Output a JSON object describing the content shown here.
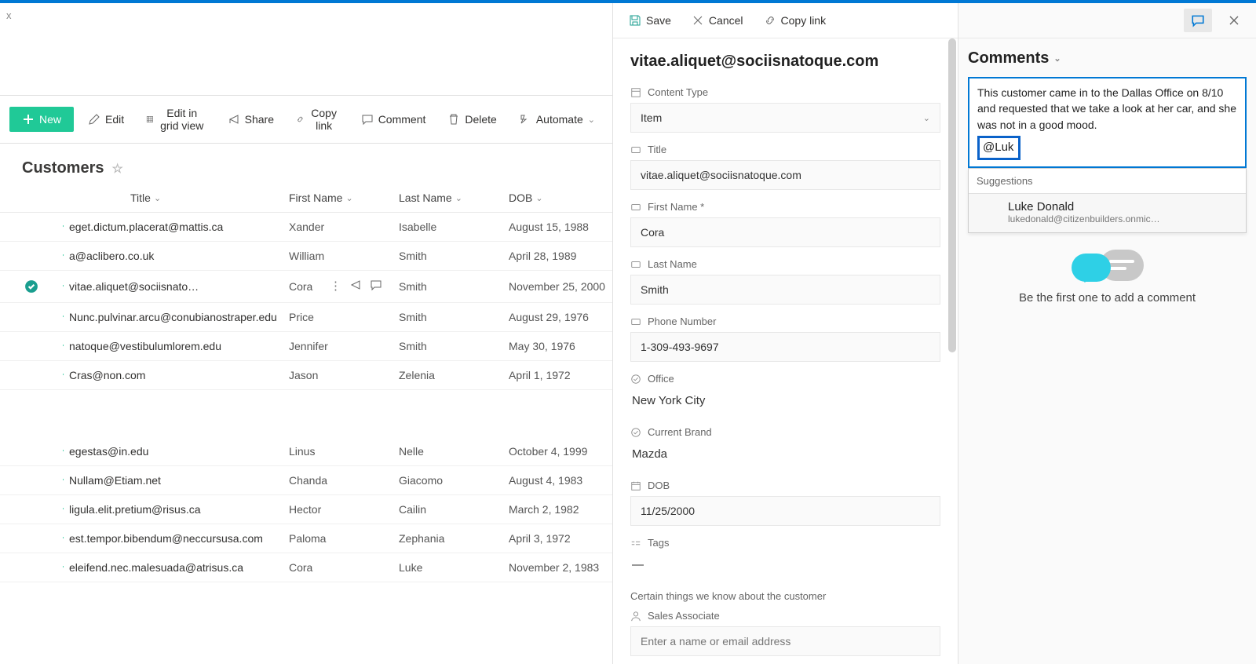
{
  "list_breadcrumb": "x",
  "commands": {
    "new": "New",
    "edit": "Edit",
    "edit_grid": "Edit in grid view",
    "share": "Share",
    "copy_link": "Copy link",
    "comment": "Comment",
    "delete": "Delete",
    "automate": "Automate"
  },
  "list_title": "Customers",
  "columns": {
    "title": "Title",
    "first": "First Name",
    "last": "Last Name",
    "dob": "DOB"
  },
  "rows": [
    {
      "title": "eget.dictum.placerat@mattis.ca",
      "first": "Xander",
      "last": "Isabelle",
      "dob": "August 15, 1988"
    },
    {
      "title": "a@aclibero.co.uk",
      "first": "William",
      "last": "Smith",
      "dob": "April 28, 1989"
    },
    {
      "title": "vitae.aliquet@sociisnato…",
      "first": "Cora",
      "last": "Smith",
      "dob": "November 25, 2000",
      "selected": true
    },
    {
      "title": "Nunc.pulvinar.arcu@conubianostraper.edu",
      "first": "Price",
      "last": "Smith",
      "dob": "August 29, 1976"
    },
    {
      "title": "natoque@vestibulumlorem.edu",
      "first": "Jennifer",
      "last": "Smith",
      "dob": "May 30, 1976"
    },
    {
      "title": "Cras@non.com",
      "first": "Jason",
      "last": "Zelenia",
      "dob": "April 1, 1972"
    }
  ],
  "rows2": [
    {
      "title": "egestas@in.edu",
      "first": "Linus",
      "last": "Nelle",
      "dob": "October 4, 1999"
    },
    {
      "title": "Nullam@Etiam.net",
      "first": "Chanda",
      "last": "Giacomo",
      "dob": "August 4, 1983"
    },
    {
      "title": "ligula.elit.pretium@risus.ca",
      "first": "Hector",
      "last": "Cailin",
      "dob": "March 2, 1982"
    },
    {
      "title": "est.tempor.bibendum@neccursusa.com",
      "first": "Paloma",
      "last": "Zephania",
      "dob": "April 3, 1972"
    },
    {
      "title": "eleifend.nec.malesuada@atrisus.ca",
      "first": "Cora",
      "last": "Luke",
      "dob": "November 2, 1983"
    }
  ],
  "panel": {
    "save": "Save",
    "cancel": "Cancel",
    "copy_link": "Copy link",
    "heading": "vitae.aliquet@sociisnatoque.com",
    "content_type_label": "Content Type",
    "content_type_value": "Item",
    "title_label": "Title",
    "title_value": "vitae.aliquet@sociisnatoque.com",
    "first_label": "First Name *",
    "first_value": "Cora",
    "last_label": "Last Name",
    "last_value": "Smith",
    "phone_label": "Phone Number",
    "phone_value": "1-309-493-9697",
    "office_label": "Office",
    "office_value": "New York City",
    "brand_label": "Current Brand",
    "brand_value": "Mazda",
    "dob_label": "DOB",
    "dob_value": "11/25/2000",
    "tags_label": "Tags",
    "tags_value": "—",
    "section_note": "Certain things we know about the customer",
    "sales_label": "Sales Associate",
    "sales_placeholder": "Enter a name or email address"
  },
  "comments": {
    "title": "Comments",
    "text": "This customer came in to the Dallas Office on 8/10 and requested that we take a look at her car, and she was not in a good mood.",
    "mention": "@Luk",
    "sugg_label": "Suggestions",
    "sugg_name": "Luke Donald",
    "sugg_email": "lukedonald@citizenbuilders.onmic…",
    "empty": "Be the first one to add a comment"
  }
}
